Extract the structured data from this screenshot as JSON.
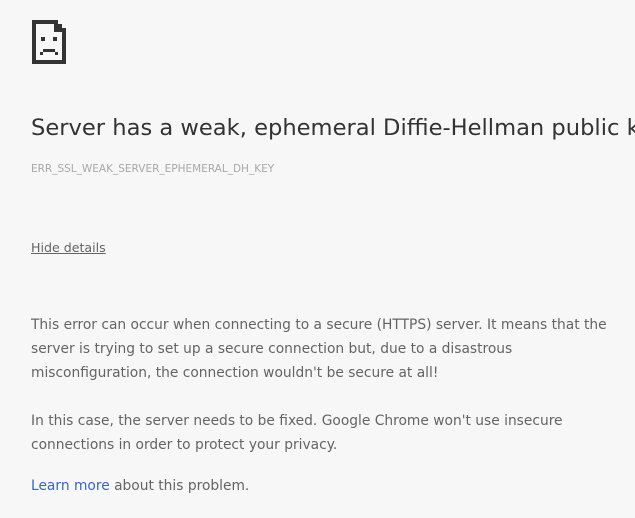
{
  "icon": "sad-page-icon",
  "title": "Server has a weak, ephemeral Diffie-Hellman public key",
  "error_code": "ERR_SSL_WEAK_SERVER_EPHEMERAL_DH_KEY",
  "details_toggle": "Hide details",
  "details": {
    "paragraph_1": "This error can occur when connecting to a secure (HTTPS) server. It means that the server is trying to set up a secure connection but, due to a disastrous misconfiguration, the connection wouldn't be secure at all!",
    "paragraph_2": "In this case, the server needs to be fixed. Google Chrome won't use insecure connections in order to protect your privacy."
  },
  "learn_more": {
    "link_text": "Learn more",
    "trailing_text": " about this problem."
  },
  "colors": {
    "background": "#f7f7f7",
    "title": "#333333",
    "body_text": "#646464",
    "error_code": "#a8a8a8",
    "link": "#3e65b8"
  }
}
